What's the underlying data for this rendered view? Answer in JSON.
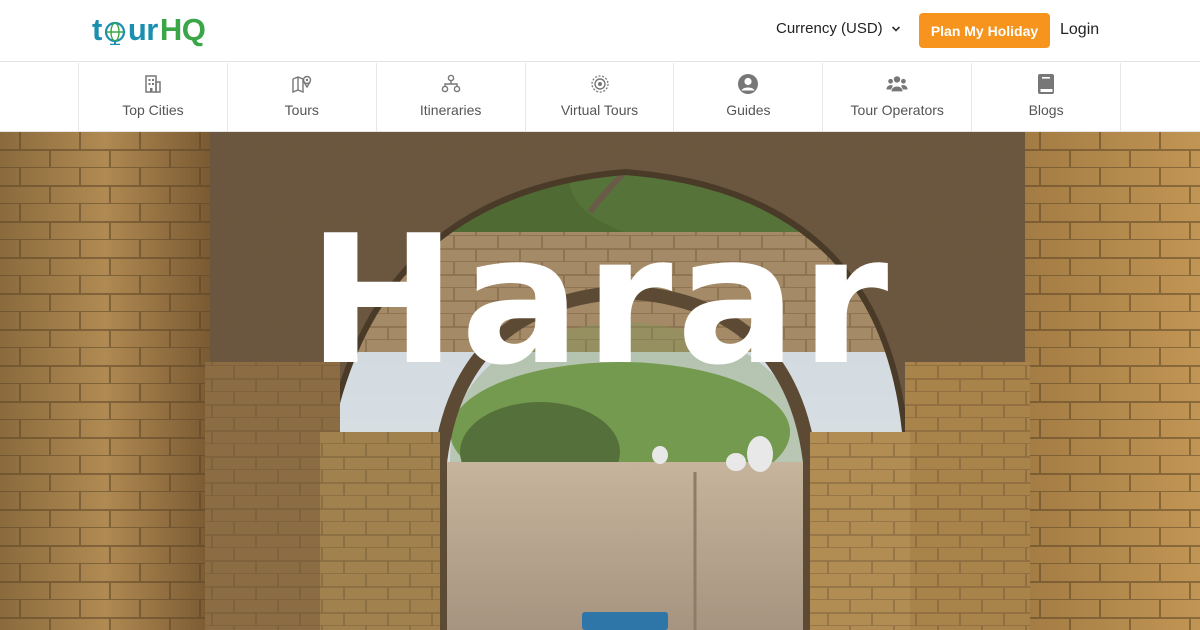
{
  "brand": {
    "logo_part1": "t",
    "logo_part2": "ur",
    "logo_part3": "HQ"
  },
  "header": {
    "currency_label": "Currency (USD)",
    "plan_button": "Plan My Holiday",
    "login_label": "Login"
  },
  "nav": {
    "items": [
      {
        "label": "Top Cities",
        "icon": "building-icon"
      },
      {
        "label": "Tours",
        "icon": "map-pin-icon"
      },
      {
        "label": "Itineraries",
        "icon": "route-icon"
      },
      {
        "label": "Virtual Tours",
        "icon": "target-icon"
      },
      {
        "label": "Guides",
        "icon": "user-circle-icon"
      },
      {
        "label": "Tour Operators",
        "icon": "users-icon"
      },
      {
        "label": "Blogs",
        "icon": "book-icon"
      }
    ]
  },
  "hero": {
    "title": "Harar"
  },
  "colors": {
    "accent": "#f7941d",
    "logo_blue": "#1a8fb0",
    "logo_green": "#3aa647"
  }
}
